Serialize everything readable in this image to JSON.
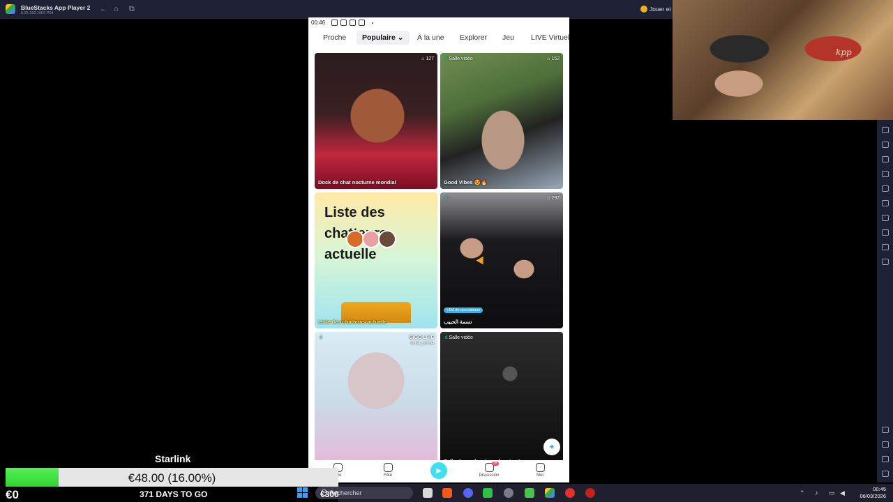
{
  "window": {
    "title": "BlueStacks App Player 2",
    "version": "5.22.160.1003 P64",
    "play_label": "Jouer et"
  },
  "phone": {
    "status_time": "00:46",
    "tabs": [
      {
        "label": "Proche"
      },
      {
        "label": "Populaire"
      },
      {
        "label": "À la une"
      },
      {
        "label": "Explorer"
      },
      {
        "label": "Jeu"
      },
      {
        "label": "LIVE Virtuel"
      }
    ],
    "cards": [
      {
        "title": "Dock de chat nocturne mondial",
        "viewers": "127"
      },
      {
        "tag": "Salle vidéo",
        "title": "Good Vibes 😍🔥",
        "viewers": "152"
      },
      {
        "heading_line1": "Liste des",
        "heading_line2": "chatteurs",
        "heading_line3": "actuelle",
        "caption": "Liste des chatteurs actuelle"
      },
      {
        "title": "نسمة الحبيب",
        "viewers": "297",
        "badge": "+1M de spectateurs"
      },
      {
        "brand": "BIGO LIVE",
        "bigo_id": "ID:MR_587654"
      },
      {
        "tag": "Salle vidéo",
        "title": "Salle de confessions du minuit"
      }
    ],
    "nav": [
      {
        "label": "Live"
      },
      {
        "label": "Fête"
      },
      {
        "label": "Discussion",
        "badge": "28"
      },
      {
        "label": "Moi"
      }
    ]
  },
  "starlink": {
    "title": "Starlink",
    "progress_text": "€48.00 (16.00%)",
    "progress": 0.16,
    "start": "€0",
    "days": "371 DAYS TO GO",
    "goal": "€300"
  },
  "taskbar": {
    "search_placeholder": "Rechercher",
    "time": "00:45",
    "date": "06/03/2026"
  },
  "webcam": {
    "shirt_text": "kpp"
  }
}
